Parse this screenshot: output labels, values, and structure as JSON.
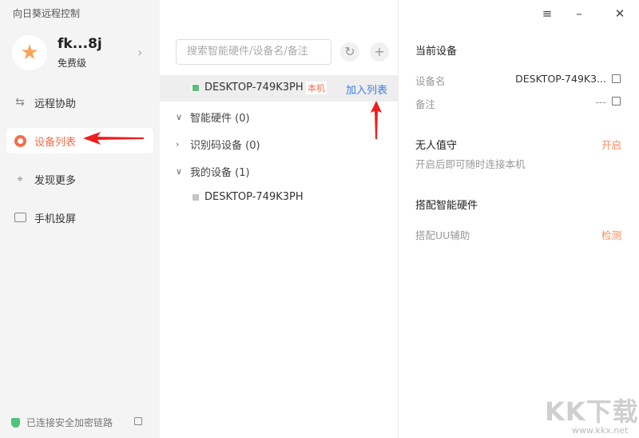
{
  "app": {
    "title": "向日葵远程控制"
  },
  "user": {
    "name": "fk...8j",
    "level": "免费级"
  },
  "nav": [
    {
      "label": "远程协助",
      "icon": "remote-assist-icon"
    },
    {
      "label": "设备列表",
      "icon": "device-list-icon",
      "active": true
    },
    {
      "label": "发现更多",
      "icon": "satellite-icon"
    },
    {
      "label": "手机投屏",
      "icon": "screen-cast-icon"
    }
  ],
  "status": {
    "text": "已连接安全加密链路"
  },
  "search": {
    "placeholder": "搜索智能硬件/设备名/备注"
  },
  "current_row": {
    "name": "DESKTOP-749K3PH",
    "badge": "本机",
    "action": "加入列表"
  },
  "groups": [
    {
      "label": "智能硬件 (0)",
      "expanded": true
    },
    {
      "label": "识别码设备 (0)",
      "expanded": false
    },
    {
      "label": "我的设备 (1)",
      "expanded": true,
      "items": [
        "DESKTOP-749K3PH"
      ]
    }
  ],
  "detail": {
    "section_title": "当前设备",
    "device_name_label": "设备名",
    "device_name_value": "DESKTOP-749K3...",
    "note_label": "备注",
    "note_value": "---",
    "unattended_title": "无人值守",
    "unattended_action": "开启",
    "unattended_desc": "开启后即可随时连接本机",
    "hardware_title": "搭配智能硬件",
    "uu_label": "搭配UU辅助",
    "uu_action": "检测"
  },
  "watermark": {
    "logo": "KK下载",
    "url": "www.kkx.net"
  },
  "colors": {
    "accent": "#f26e4a",
    "link": "#3b7ee8",
    "arrow": "#f01d1d"
  }
}
